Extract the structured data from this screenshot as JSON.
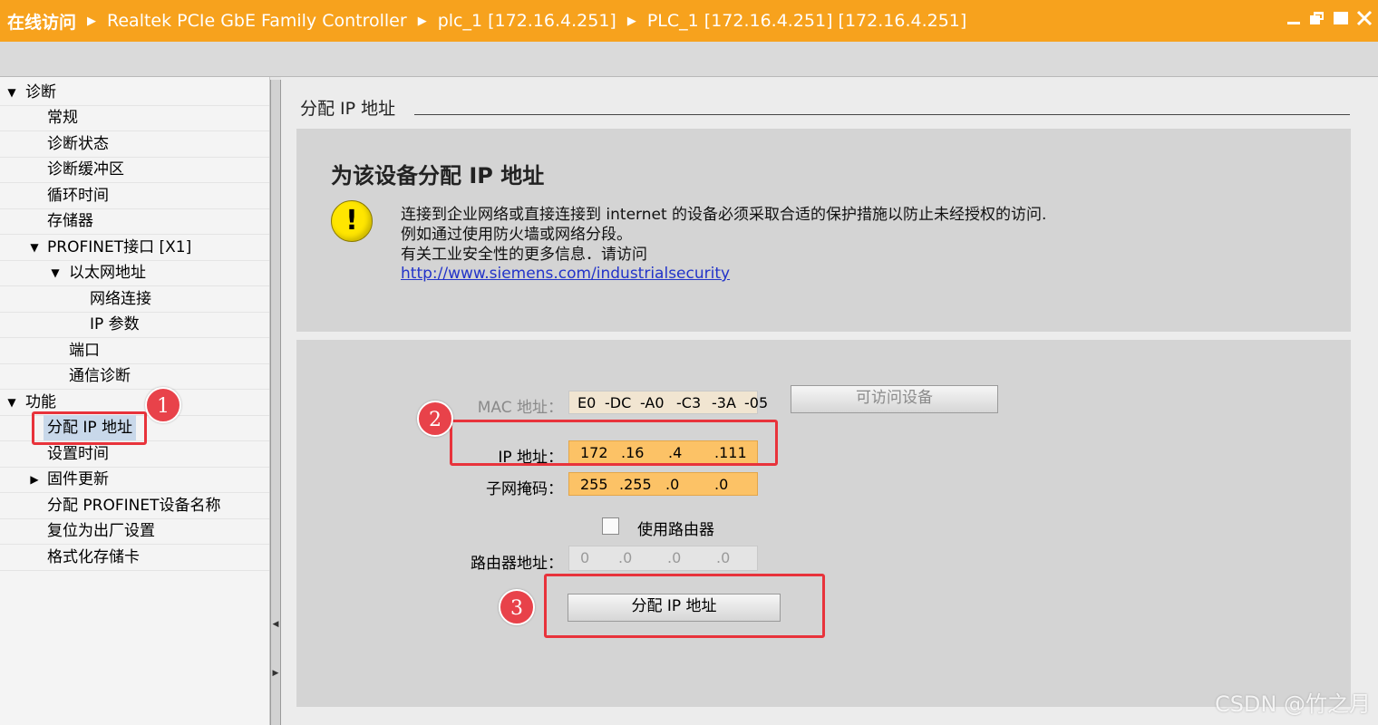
{
  "titlebar": {
    "crumbs": [
      "在线访问",
      "Realtek PCIe GbE Family Controller",
      "plc_1 [172.16.4.251]",
      "PLC_1 [172.16.4.251] [172.16.4.251]"
    ],
    "bg_color": "#f7a21d",
    "controls": [
      "minimize-icon",
      "restore-icon",
      "maximize-icon",
      "close-icon"
    ]
  },
  "tree": {
    "items": [
      {
        "label": "诊断",
        "arrow": "▼"
      },
      {
        "label": "常规"
      },
      {
        "label": "诊断状态"
      },
      {
        "label": "诊断缓冲区"
      },
      {
        "label": "循环时间"
      },
      {
        "label": "存储器"
      },
      {
        "label": "PROFINET接口 [X1]",
        "arrow": "▼"
      },
      {
        "label": "以太网地址",
        "arrow": "▼"
      },
      {
        "label": "网络连接"
      },
      {
        "label": "IP 参数"
      },
      {
        "label": "端口"
      },
      {
        "label": "通信诊断"
      },
      {
        "label": "功能",
        "arrow": "▼"
      },
      {
        "label": "分配 IP 地址",
        "selected": true
      },
      {
        "label": "设置时间"
      },
      {
        "label": "固件更新",
        "arrow": "▶"
      },
      {
        "label": "分配 PROFINET设备名称"
      },
      {
        "label": "复位为出厂设置"
      },
      {
        "label": "格式化存储卡"
      }
    ]
  },
  "main": {
    "section_title": "分配 IP 地址",
    "info": {
      "heading": "为该设备分配 IP 地址",
      "lines": [
        "连接到企业网络或直接连接到 internet 的设备必须采取合适的保护措施以防止未经授权的访问.",
        "例如通过使用防火墙或网络分段。",
        "有关工业安全性的更多信息．请访问"
      ],
      "link": "http://www.siemens.com/industrialsecurity"
    },
    "form": {
      "mac_label": "MAC 地址：",
      "mac_parts": [
        "E0",
        "-DC",
        "-A0",
        "-C3",
        "-3A",
        "-05"
      ],
      "browse_button": "可访问设备",
      "ip_label": "IP 地址：",
      "ip_parts": [
        "172",
        ".16",
        ".4",
        ".111"
      ],
      "subnet_label": "子网掩码：",
      "subnet_parts": [
        "255",
        ".255",
        ".0",
        ".0"
      ],
      "router_checkbox_label": "使用路由器",
      "router_checked": false,
      "router_label": "路由器地址：",
      "router_parts": [
        "0",
        ".0",
        ".0",
        ".0"
      ],
      "assign_button": "分配 IP 地址"
    }
  },
  "annotations": {
    "markers": [
      "1",
      "2",
      "3"
    ],
    "color": "#e8333b"
  },
  "watermark": "CSDN @竹之月"
}
